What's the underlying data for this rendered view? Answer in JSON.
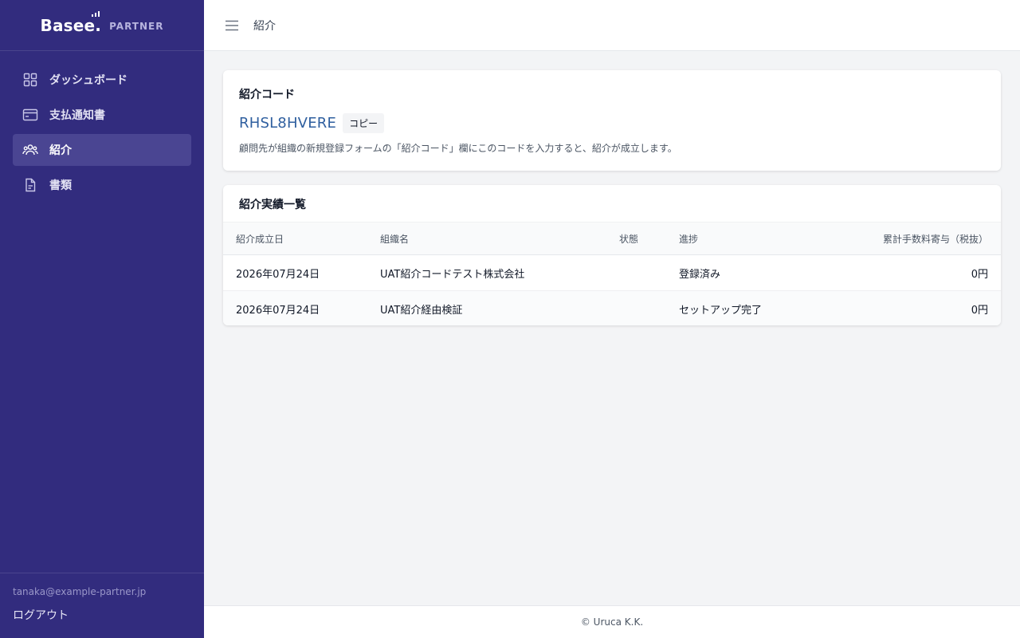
{
  "brand": {
    "logo": "Basee.",
    "sub": "PARTNER"
  },
  "sidebar": {
    "items": [
      {
        "label": "ダッシュボード",
        "icon": "grid-icon",
        "active": false
      },
      {
        "label": "支払通知書",
        "icon": "credit-card-icon",
        "active": false
      },
      {
        "label": "紹介",
        "icon": "users-icon",
        "active": true
      },
      {
        "label": "書類",
        "icon": "document-icon",
        "active": false
      }
    ],
    "user_email": "tanaka@example-partner.jp",
    "logout_label": "ログアウト"
  },
  "header": {
    "title": "紹介",
    "menu_icon": "hamburger-icon"
  },
  "referral": {
    "title": "紹介コード",
    "code": "RHSL8HVERE",
    "copy_label": "コピー",
    "hint": "顧問先が組織の新規登録フォームの「紹介コード」欄にこのコードを入力すると、紹介が成立します。"
  },
  "results": {
    "title": "紹介実績一覧",
    "columns": [
      "紹介成立日",
      "組織名",
      "状態",
      "進捗",
      "累計手数料寄与（税抜）"
    ],
    "rows": [
      {
        "date": "2026年07月24日",
        "org": "UAT紹介コードテスト株式会社",
        "status": "",
        "progress": "登録済み",
        "fee": "0円"
      },
      {
        "date": "2026年07月24日",
        "org": "UAT紹介経由検証",
        "status": "",
        "progress": "セットアップ完了",
        "fee": "0円"
      }
    ]
  },
  "footer": {
    "copyright": "© Uruca K.K."
  },
  "colors": {
    "sidebar_bg": "#322c7e",
    "active_item": "#4a4592",
    "code_link": "#2f5f9f"
  }
}
